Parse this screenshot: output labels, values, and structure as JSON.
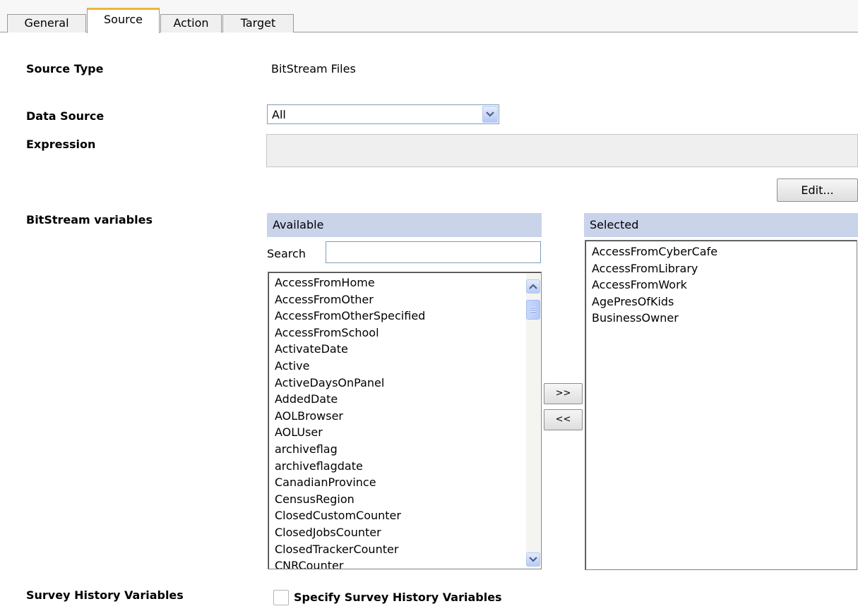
{
  "tabs": [
    {
      "label": "General",
      "active": false
    },
    {
      "label": "Source",
      "active": true
    },
    {
      "label": "Action",
      "active": false
    },
    {
      "label": "Target",
      "active": false
    }
  ],
  "form": {
    "source_type_label": "Source Type",
    "source_type_value": "BitStream Files",
    "data_source_label": "Data Source",
    "data_source_value": "All",
    "expression_label": "Expression",
    "expression_value": "",
    "edit_button": "Edit...",
    "variables_label": "BitStream variables",
    "survey_history_label": "Survey History Variables",
    "survey_history_checkbox_label": "Specify Survey History Variables",
    "survey_history_checked": false
  },
  "available": {
    "header": "Available",
    "search_label": "Search",
    "search_value": "",
    "items": [
      "AccessFromHome",
      "AccessFromOther",
      "AccessFromOtherSpecified",
      "AccessFromSchool",
      "ActivateDate",
      "Active",
      "ActiveDaysOnPanel",
      "AddedDate",
      "AOLBrowser",
      "AOLUser",
      "archiveflag",
      "archiveflagdate",
      "CanadianProvince",
      "CensusRegion",
      "ClosedCustomCounter",
      "ClosedJobsCounter",
      "ClosedTrackerCounter",
      "CNRCounter"
    ]
  },
  "transfer": {
    "add_label": ">>",
    "remove_label": "<<"
  },
  "selected": {
    "header": "Selected",
    "items": [
      "AccessFromCyberCafe",
      "AccessFromLibrary",
      "AccessFromWork",
      "AgePresOfKids",
      "BusinessOwner"
    ]
  },
  "colors": {
    "active_tab_accent": "#f0b43c",
    "panel_header_bg": "#c9d3ea",
    "input_border": "#7f9db9"
  }
}
